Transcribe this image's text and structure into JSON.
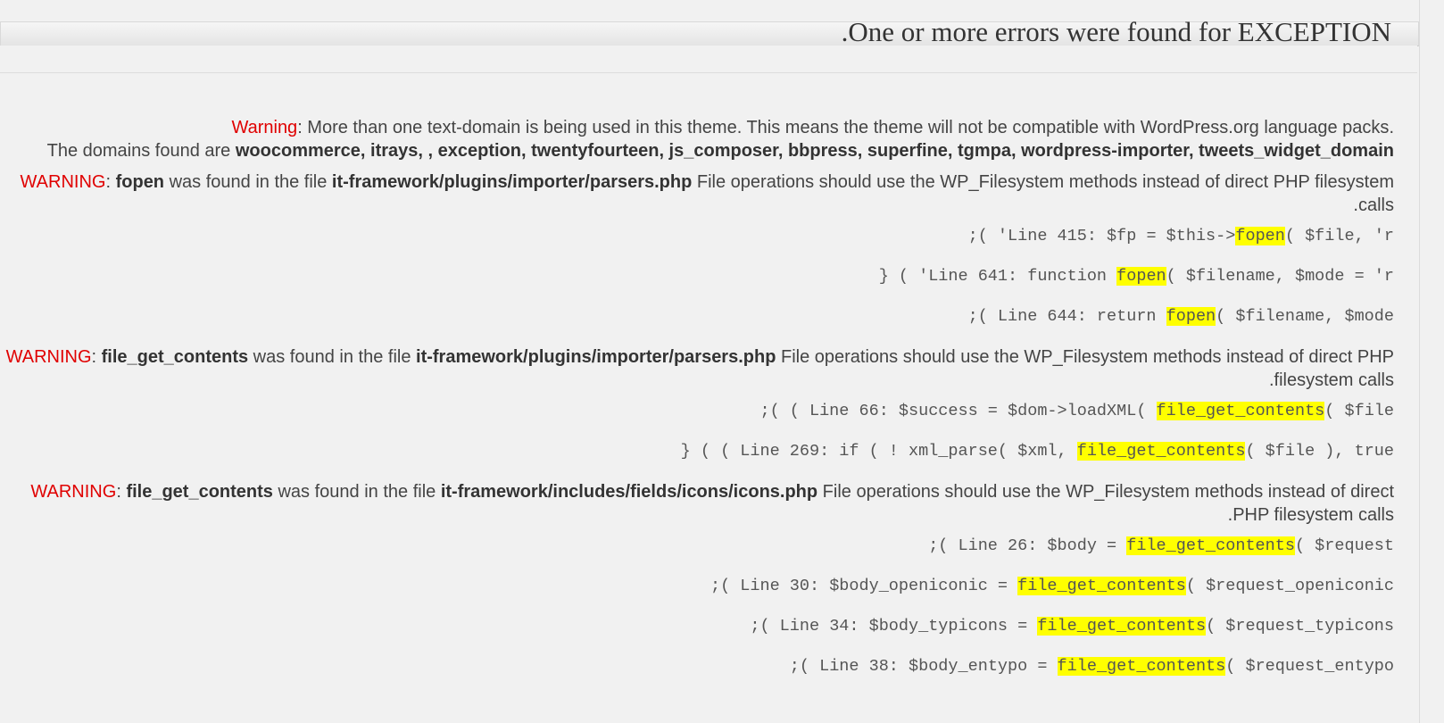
{
  "header": {
    "title": ".One or more errors were found for EXCEPTION"
  },
  "warning_domains": {
    "label": "Warning",
    "lead": ".",
    "text": ": More than one text-domain is being used in this theme. This means the theme will not be compatible with WordPress.org language packs",
    "domains_prefix": "The domains found are ",
    "domains": "woocommerce, itrays, , exception, twentyfourteen, js_composer, bbpress, superfine, tgmpa, wordpress-importer, tweets_widget_domain"
  },
  "warnings": [
    {
      "label": "WARNING",
      "func": "fopen",
      "mid": " was found in the file ",
      "file": "it-framework/plugins/importer/parsers.php",
      "text": " File operations should use the WP_Filesystem methods instead of direct PHP filesystem calls.",
      "lines": [
        {
          "pre": ";( 'Line 415: $fp = $this->",
          "fn": "fopen",
          "post": "( $file, 'r"
        },
        {
          "pre": "} ( 'Line 641: function ",
          "fn": "fopen",
          "post": "( $filename, $mode = 'r"
        },
        {
          "pre": ";( Line 644: return ",
          "fn": "fopen",
          "post": "( $filename, $mode"
        }
      ]
    },
    {
      "label": "WARNING",
      "func": "file_get_contents",
      "mid": " was found in the file ",
      "file": "it-framework/plugins/importer/parsers.php",
      "text": " File operations should use the WP_Filesystem methods instead of direct PHP filesystem calls.",
      "lines": [
        {
          "pre": ";( ( Line 66: $success = $dom->loadXML( ",
          "fn": "file_get_contents",
          "post": "( $file"
        },
        {
          "pre": "} ( ( Line 269: if ( ! xml_parse( $xml, ",
          "fn": "file_get_contents",
          "post": "( $file ), true"
        }
      ]
    },
    {
      "label": "WARNING",
      "func": "file_get_contents",
      "mid": " was found in the file ",
      "file": "it-framework/includes/fields/icons/icons.php",
      "text": " File operations should use the WP_Filesystem methods instead of direct PHP filesystem calls.",
      "lines": [
        {
          "pre": ";( Line 26: $body = ",
          "fn": "file_get_contents",
          "post": "( $request"
        },
        {
          "pre": ";( Line 30: $body_openiconic = ",
          "fn": "file_get_contents",
          "post": "( $request_openiconic"
        },
        {
          "pre": ";( Line 34: $body_typicons = ",
          "fn": "file_get_contents",
          "post": "( $request_typicons"
        },
        {
          "pre": ";( Line 38: $body_entypo = ",
          "fn": "file_get_contents",
          "post": "( $request_entypo"
        }
      ]
    }
  ]
}
